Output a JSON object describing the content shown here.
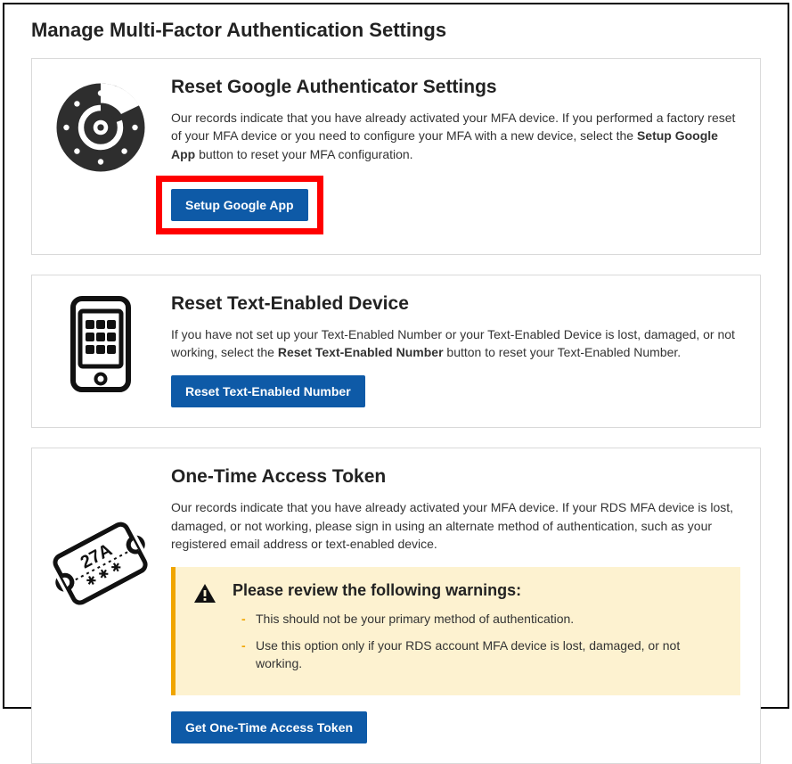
{
  "page": {
    "title": "Manage Multi-Factor Authentication Settings"
  },
  "section1": {
    "title": "Reset Google Authenticator Settings",
    "desc_pre": "Our records indicate that you have already activated your MFA device. If you performed a factory reset of your MFA device or you need to configure your MFA with a new device, select the ",
    "desc_bold": "Setup Google App",
    "desc_post": " button to reset your MFA configuration.",
    "button": "Setup Google App"
  },
  "section2": {
    "title": "Reset Text-Enabled Device",
    "desc_pre": "If you have not set up your Text-Enabled Number or your Text-Enabled Device is lost, damaged, or not working, select the ",
    "desc_bold": "Reset Text-Enabled Number",
    "desc_post": " button to reset your Text-Enabled Number.",
    "button": "Reset Text-Enabled Number"
  },
  "section3": {
    "title": "One-Time Access Token",
    "desc": "Our records indicate that you have already activated your MFA device. If your RDS MFA device is lost, damaged, or not working, please sign in using an alternate method of authentication, such as your registered email address or text-enabled device.",
    "warning_title": "Please review the following warnings:",
    "warnings": [
      "This should not be your primary method of authentication.",
      "Use this option only if your RDS account MFA device is lost, damaged, or not working."
    ],
    "button": "Get One-Time Access Token"
  }
}
